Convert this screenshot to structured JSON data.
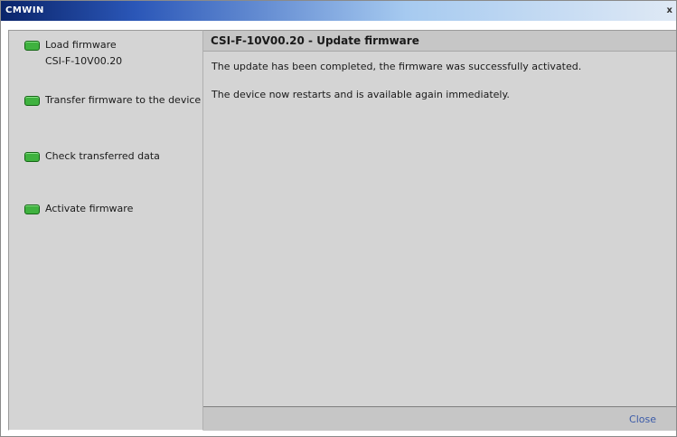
{
  "window": {
    "title": "CMWIN",
    "close_glyph": "x"
  },
  "sidebar": {
    "steps": [
      {
        "label": "Load firmware",
        "sub": "CSI-F-10V00.20",
        "status_color": "#3fb23f"
      },
      {
        "label": "Transfer firmware to the device",
        "status_color": "#3fb23f"
      },
      {
        "label": "Check transferred data",
        "status_color": "#3fb23f"
      },
      {
        "label": "Activate firmware",
        "status_color": "#3fb23f"
      }
    ]
  },
  "main": {
    "title": "CSI-F-10V00.20 - Update firmware",
    "messages": [
      "The update has been completed, the firmware was successfully activated.",
      "The device now restarts and is available again immediately."
    ],
    "close_label": "Close"
  },
  "colors": {
    "link": "#3a5aa8",
    "panel": "#d4d4d4",
    "header": "#c6c6c6",
    "status_ok": "#3fb23f"
  }
}
